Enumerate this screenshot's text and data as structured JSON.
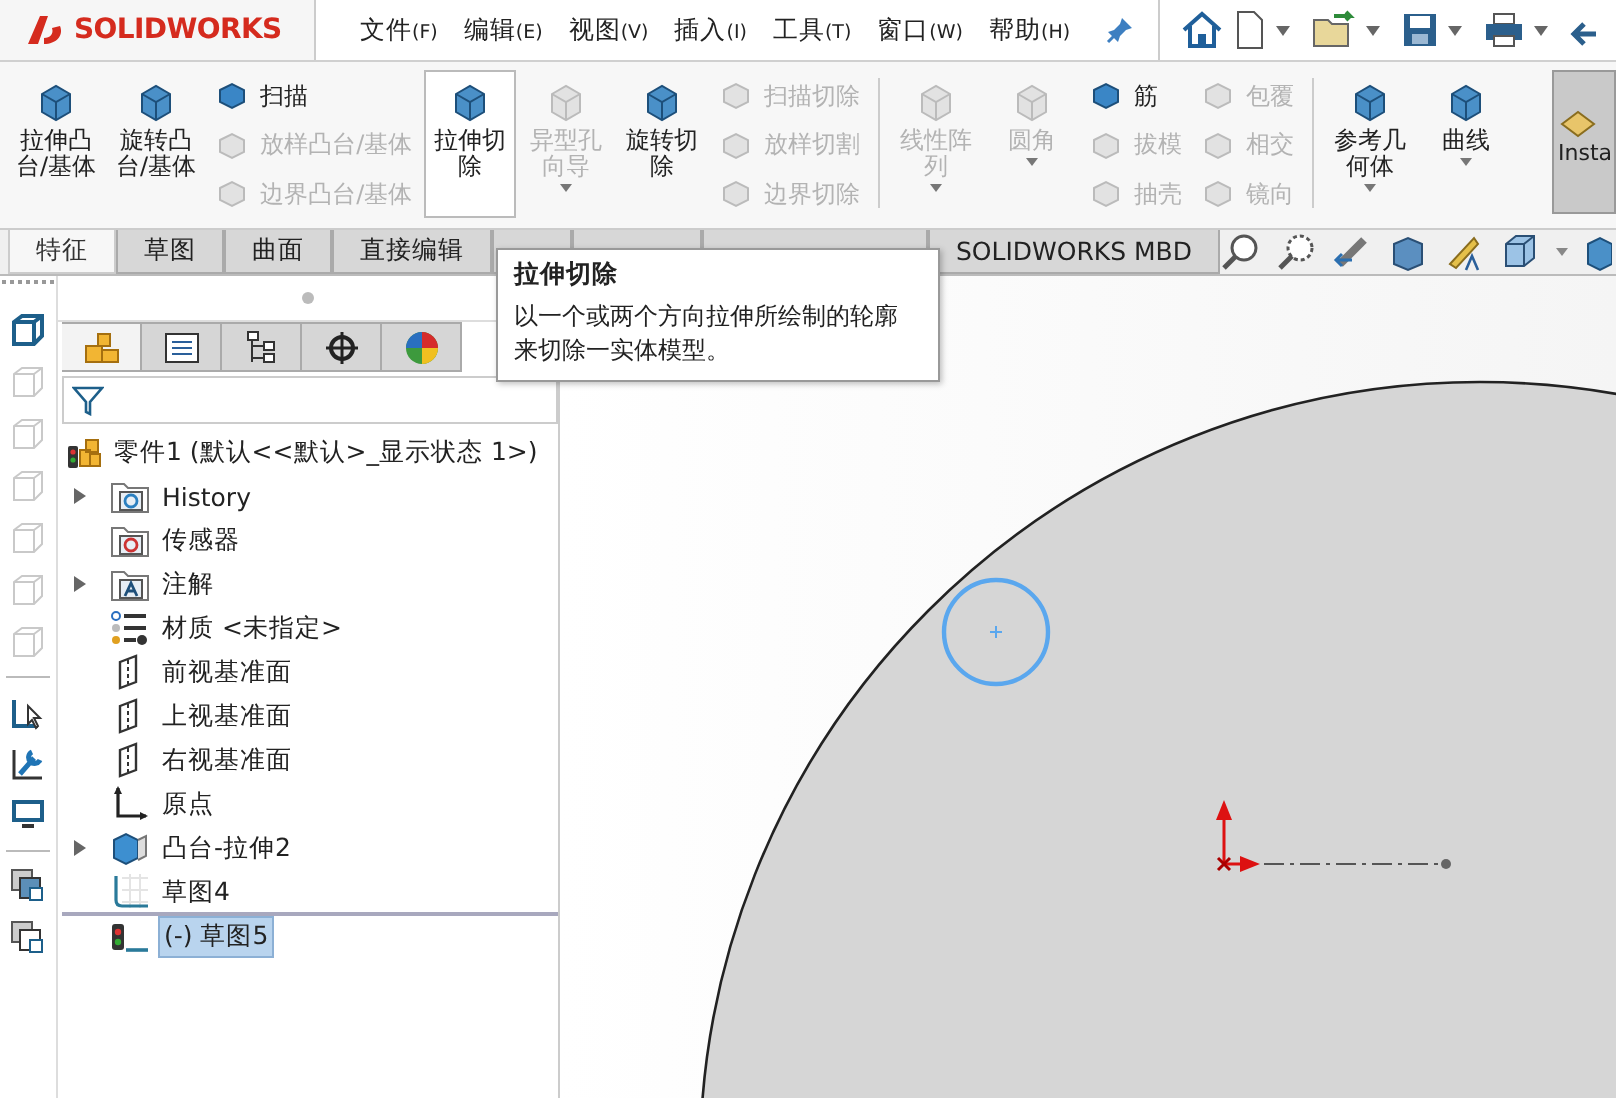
{
  "app": {
    "logo": "SOLIDWORKS"
  },
  "menu": [
    {
      "label": "文件",
      "key": "(F)"
    },
    {
      "label": "编辑",
      "key": "(E)"
    },
    {
      "label": "视图",
      "key": "(V)"
    },
    {
      "label": "插入",
      "key": "(I)"
    },
    {
      "label": "工具",
      "key": "(T)"
    },
    {
      "label": "窗口",
      "key": "(W)"
    },
    {
      "label": "帮助",
      "key": "(H)"
    }
  ],
  "ribbon": [
    {
      "kind": "large",
      "label_lines": [
        "拉伸凸",
        "台/基体"
      ],
      "disabled": false,
      "highlighted": false,
      "dropdown": false
    },
    {
      "kind": "large",
      "label_lines": [
        "旋转凸",
        "台/基体"
      ],
      "disabled": false,
      "highlighted": false,
      "dropdown": false
    },
    {
      "kind": "stack",
      "items": [
        {
          "label": "扫描",
          "disabled": false
        },
        {
          "label": "放样凸台/基体",
          "disabled": true
        },
        {
          "label": "边界凸台/基体",
          "disabled": true
        }
      ]
    },
    {
      "kind": "large",
      "label_lines": [
        "拉伸切",
        "除"
      ],
      "disabled": false,
      "highlighted": true,
      "dropdown": false
    },
    {
      "kind": "large",
      "label_lines": [
        "异型孔",
        "向导"
      ],
      "disabled": true,
      "highlighted": false,
      "dropdown": true
    },
    {
      "kind": "large",
      "label_lines": [
        "旋转切",
        "除"
      ],
      "disabled": false,
      "highlighted": false,
      "dropdown": false
    },
    {
      "kind": "stack",
      "items": [
        {
          "label": "扫描切除",
          "disabled": true
        },
        {
          "label": "放样切割",
          "disabled": true
        },
        {
          "label": "边界切除",
          "disabled": true
        }
      ]
    },
    {
      "kind": "separator"
    },
    {
      "kind": "large",
      "label_lines": [
        "线性阵",
        "列"
      ],
      "disabled": true,
      "highlighted": false,
      "dropdown": true
    },
    {
      "kind": "large",
      "label_lines": [
        "圆角"
      ],
      "disabled": true,
      "highlighted": false,
      "dropdown": true
    },
    {
      "kind": "stack",
      "items": [
        {
          "label": "筋",
          "disabled": false
        },
        {
          "label": "拔模",
          "disabled": true
        },
        {
          "label": "抽壳",
          "disabled": true
        }
      ]
    },
    {
      "kind": "stack",
      "items": [
        {
          "label": "包覆",
          "disabled": true
        },
        {
          "label": "相交",
          "disabled": true
        },
        {
          "label": "镜向",
          "disabled": true
        }
      ]
    },
    {
      "kind": "separator"
    },
    {
      "kind": "large",
      "label_lines": [
        "参考几",
        "何体"
      ],
      "disabled": false,
      "highlighted": false,
      "dropdown": true
    },
    {
      "kind": "large",
      "label_lines": [
        "曲线"
      ],
      "disabled": false,
      "highlighted": false,
      "dropdown": true
    },
    {
      "kind": "addin",
      "label_lines": [
        "Insta"
      ]
    }
  ],
  "tabs": [
    {
      "label": "特征",
      "selected": true
    },
    {
      "label": "草图",
      "selected": false
    },
    {
      "label": "曲面",
      "selected": false
    },
    {
      "label": "直接编辑",
      "selected": false
    },
    {
      "selected": false
    },
    {
      "selected": false
    },
    {
      "selected": false
    },
    {
      "label": "SOLIDWORKS MBD",
      "selected": false
    }
  ],
  "tooltip": {
    "title": "拉伸切除",
    "lines": [
      "以一个或两个方向拉伸所绘制的轮廓",
      "来切除一实体模型。"
    ]
  },
  "panel_tabs": [
    {
      "kind": "feature-tree",
      "selected": true
    },
    {
      "kind": "property",
      "selected": false
    },
    {
      "kind": "configuration",
      "selected": false
    },
    {
      "kind": "dimxpert",
      "selected": false
    },
    {
      "kind": "display",
      "selected": false
    }
  ],
  "tree": {
    "root": {
      "label": "零件1  (默认<<默认>_显示状态 1>)"
    },
    "items": [
      {
        "label": "History",
        "kind": "history",
        "expandable": true,
        "selected": false
      },
      {
        "label": "传感器",
        "kind": "sensor",
        "expandable": false,
        "selected": false
      },
      {
        "label": "注解",
        "kind": "annotation",
        "expandable": true,
        "selected": false
      },
      {
        "label": "材质 <未指定>",
        "kind": "material",
        "expandable": false,
        "selected": false
      },
      {
        "label": "前视基准面",
        "kind": "plane",
        "expandable": false,
        "selected": false
      },
      {
        "label": "上视基准面",
        "kind": "plane",
        "expandable": false,
        "selected": false
      },
      {
        "label": "右视基准面",
        "kind": "plane",
        "expandable": false,
        "selected": false
      },
      {
        "label": "原点",
        "kind": "origin",
        "expandable": false,
        "selected": false
      },
      {
        "label": "凸台-拉伸2",
        "kind": "extrude",
        "expandable": true,
        "selected": false
      },
      {
        "label": "草图4",
        "kind": "sketch",
        "expandable": false,
        "selected": false
      },
      {
        "label": "(-) 草图5",
        "kind": "sketch-edit",
        "expandable": false,
        "selected": true
      }
    ]
  }
}
